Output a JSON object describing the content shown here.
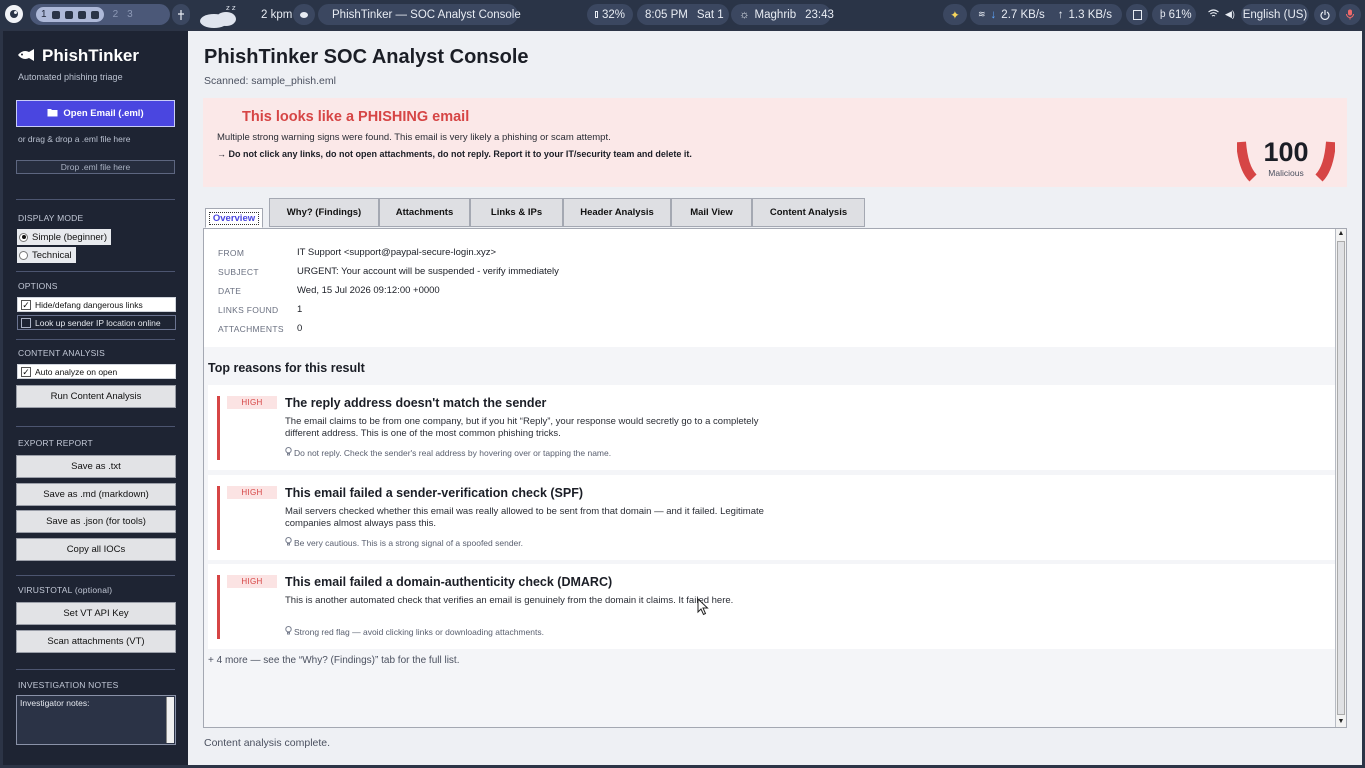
{
  "topbar": {
    "workspace_active": "1",
    "workspaces": [
      "2",
      "3"
    ],
    "weather_speed": "2 kpm",
    "window_title": "PhishTinker — SOC Analyst Console",
    "cpu": "32%",
    "time": "8:05 PM",
    "date": "Sat 1",
    "prayer": "Maghrib",
    "prayer_time": "23:43",
    "net_down": "2.7 KB/s",
    "net_up": "1.3 KB/s",
    "battery": "61%",
    "language": "English (US)"
  },
  "sidebar": {
    "brand": "PhishTinker",
    "tagline": "Automated phishing triage",
    "open_button": "Open Email (.eml)",
    "drag_hint": "or drag & drop a .eml file here",
    "dropzone": "Drop .eml file here",
    "display_mode_label": "DISPLAY MODE",
    "mode_simple": "Simple (beginner)",
    "mode_technical": "Technical",
    "options_label": "OPTIONS",
    "opt_defang": "Hide/defang dangerous links",
    "opt_geo": "Look up sender IP location online",
    "content_label": "CONTENT ANALYSIS",
    "opt_auto": "Auto analyze on open",
    "run_button": "Run Content Analysis",
    "export_label": "EXPORT REPORT",
    "export_txt": "Save as .txt",
    "export_md": "Save as .md (markdown)",
    "export_json": "Save as .json (for tools)",
    "copy_iocs": "Copy all IOCs",
    "vt_label": "VIRUSTOTAL (optional)",
    "vt_key": "Set VT API Key",
    "vt_scan": "Scan attachments (VT)",
    "notes_label": "INVESTIGATION NOTES",
    "notes_text": "Investigator notes:"
  },
  "main": {
    "title": "PhishTinker SOC Analyst Console",
    "scanned": "Scanned: sample_phish.eml",
    "verdict": {
      "title": "This looks like a PHISHING email",
      "description": "Multiple strong warning signs were found. This email is very likely a phishing or scam attempt.",
      "action": "→ Do not click any links, do not open attachments, do not reply. Report it to your IT/security team and delete it.",
      "score": "100",
      "score_label": "Malicious",
      "score_fraction": 1.0,
      "color": "#d64545"
    },
    "tabs": [
      "Overview",
      "Why? (Findings)",
      "Attachments",
      "Links & IPs",
      "Header Analysis",
      "Mail View",
      "Content Analysis"
    ],
    "fields": {
      "from_label": "FROM",
      "from": "IT Support <support@paypal-secure-login.xyz>",
      "subject_label": "SUBJECT",
      "subject": "URGENT: Your account will be suspended - verify immediately",
      "date_label": "DATE",
      "date": "Wed, 15 Jul 2026 09:12:00 +0000",
      "links_label": "LINKS FOUND",
      "links": "1",
      "attach_label": "ATTACHMENTS",
      "attachments": "0"
    },
    "reasons_title": "Top reasons for this result",
    "reasons": [
      {
        "severity": "HIGH",
        "title": "The reply address doesn't match the sender",
        "description": "The email claims to be from one company, but if you hit “Reply”, your response would secretly go to a completely different address. This is one of the most common phishing tricks.",
        "tip": "Do not reply. Check the sender's real address by hovering over or tapping the name."
      },
      {
        "severity": "HIGH",
        "title": "This email failed a sender-verification check (SPF)",
        "description": "Mail servers checked whether this email was really allowed to be sent from that domain — and it failed. Legitimate companies almost always pass this.",
        "tip": "Be very cautious. This is a strong signal of a spoofed sender."
      },
      {
        "severity": "HIGH",
        "title": "This email failed a domain-authenticity check (DMARC)",
        "description": "This is another automated check that verifies an email is genuinely from the domain it claims. It failed here.",
        "tip": "Strong red flag — avoid clicking links or downloading attachments."
      }
    ],
    "more": "+ 4 more — see the “Why? (Findings)” tab for the full list.",
    "status": "Content analysis complete."
  },
  "colors": {
    "accent": "#4a46e0",
    "danger": "#d64545",
    "sidebar": "#1e2433"
  }
}
